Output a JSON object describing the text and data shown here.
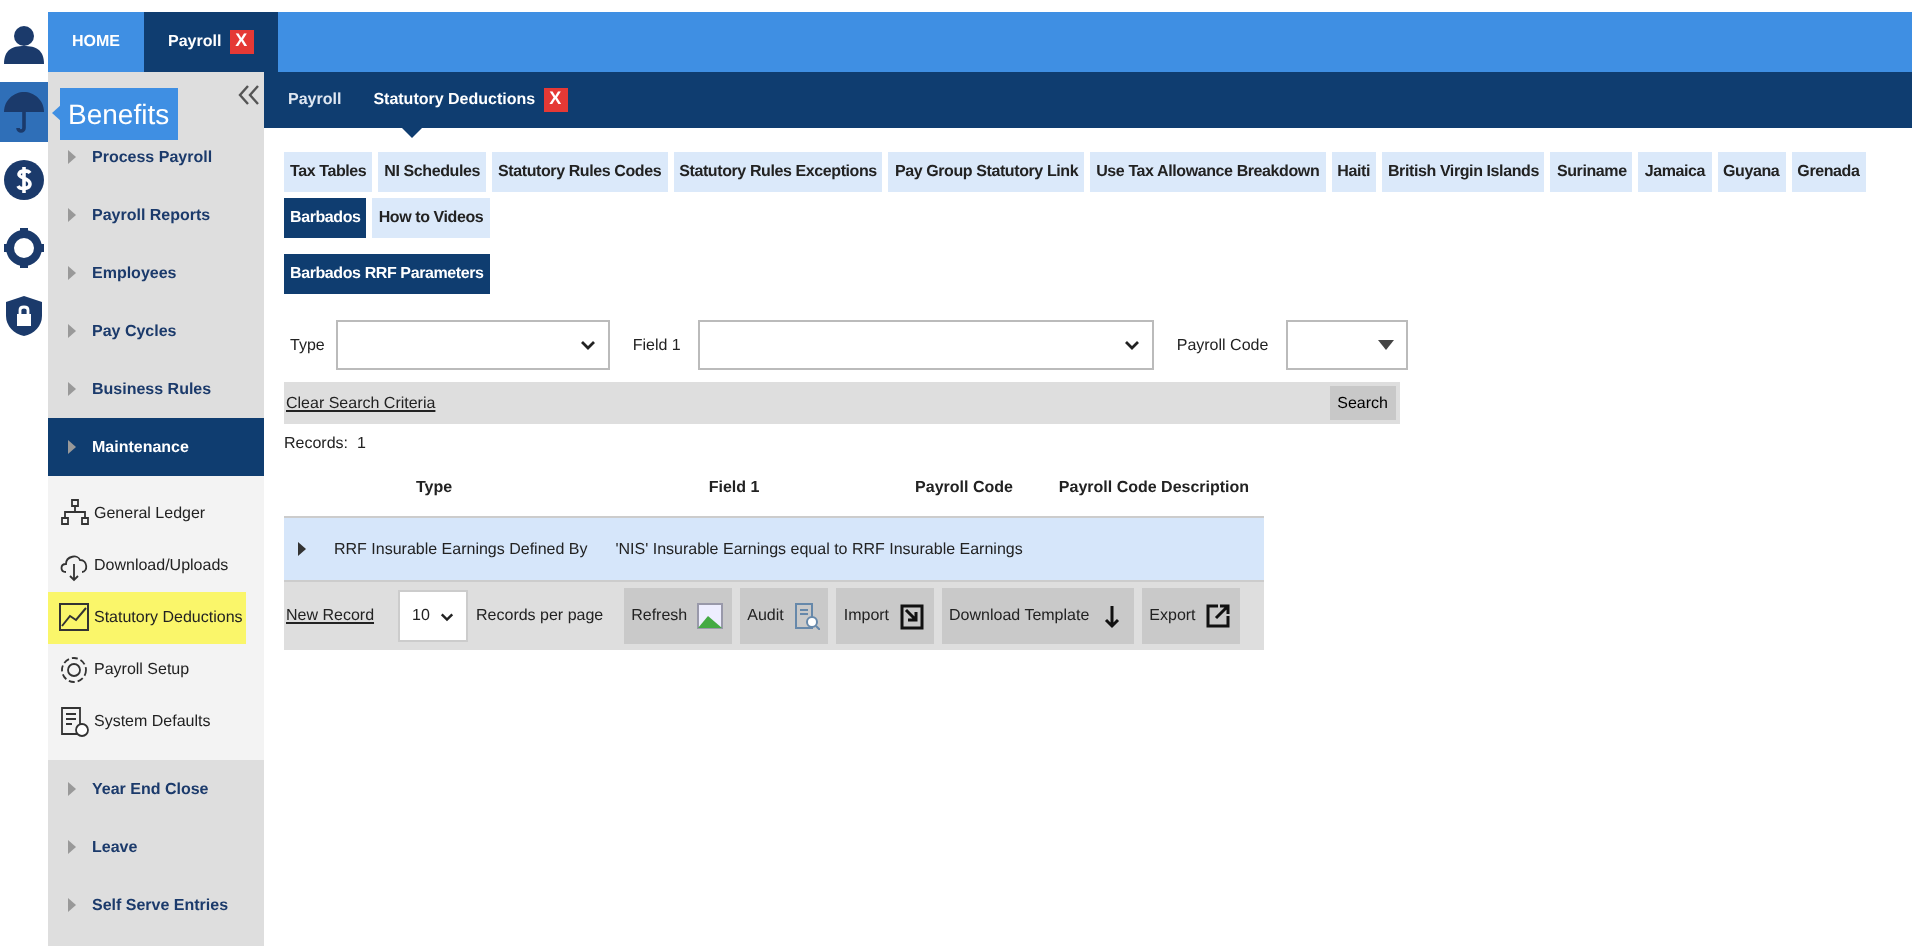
{
  "rail_icons": [
    {
      "kind": "user",
      "selected": false
    },
    {
      "kind": "umbrella",
      "selected": true
    },
    {
      "kind": "dollar",
      "selected": false
    },
    {
      "kind": "gear",
      "selected": false
    },
    {
      "kind": "shield",
      "selected": false
    }
  ],
  "tooltip": "Benefits",
  "top_tabs": [
    {
      "label": "HOME",
      "selected": false
    },
    {
      "label": "Payroll",
      "selected": true,
      "close": "X"
    }
  ],
  "sidebar": {
    "sections": [
      {
        "label": "Process Payroll",
        "expanded": false
      },
      {
        "label": "Payroll Reports",
        "expanded": false
      },
      {
        "label": "Employees",
        "expanded": false
      },
      {
        "label": "Pay Cycles",
        "expanded": false
      },
      {
        "label": "Business Rules",
        "expanded": false
      },
      {
        "label": "Maintenance",
        "expanded": true,
        "children": [
          {
            "label": "General Ledger",
            "kind": "tree",
            "highlighted": false
          },
          {
            "label": "Download/Uploads",
            "kind": "cloud",
            "highlighted": false
          },
          {
            "label": "Statutory Deductions",
            "kind": "chart",
            "highlighted": true
          },
          {
            "label": "Payroll Setup",
            "kind": "gear",
            "highlighted": false
          },
          {
            "label": "System Defaults",
            "kind": "doc",
            "highlighted": false
          }
        ]
      },
      {
        "label": "Year End Close",
        "expanded": false
      },
      {
        "label": "Leave",
        "expanded": false
      },
      {
        "label": "Self Serve Entries",
        "expanded": false
      }
    ]
  },
  "page_tabs": [
    {
      "label": "Payroll",
      "selected": false
    },
    {
      "label": "Statutory Deductions",
      "selected": true,
      "close": "X"
    }
  ],
  "sub_tabs": [
    {
      "label": "Tax Tables",
      "selected": false
    },
    {
      "label": "NI Schedules",
      "selected": false
    },
    {
      "label": "Statutory Rules Codes",
      "selected": false
    },
    {
      "label": "Statutory Rules Exceptions",
      "selected": false
    },
    {
      "label": "Pay Group Statutory Link",
      "selected": false
    },
    {
      "label": "Use Tax Allowance Breakdown",
      "selected": false
    },
    {
      "label": "Haiti",
      "selected": false
    },
    {
      "label": "British Virgin Islands",
      "selected": false
    },
    {
      "label": "Suriname",
      "selected": false
    },
    {
      "label": "Jamaica",
      "selected": false
    },
    {
      "label": "Guyana",
      "selected": false
    },
    {
      "label": "Grenada",
      "selected": false
    },
    {
      "label": "Barbados",
      "selected": true
    },
    {
      "label": "How to Videos",
      "selected": false
    }
  ],
  "section_tabs": [
    {
      "label": "Barbados RRF Parameters",
      "selected": true
    }
  ],
  "filters": [
    {
      "label": "Type",
      "kind": "select"
    },
    {
      "label": "Field 1",
      "kind": "wide"
    },
    {
      "label": "Payroll Code",
      "kind": "small"
    }
  ],
  "clear_link": "Clear Search Criteria",
  "search_button": "Search",
  "records": "Records:  1",
  "table": {
    "columns": [
      "Type",
      "Field 1",
      "Payroll Code",
      "Payroll Code Description"
    ],
    "rows": [
      {
        "expanded": false,
        "cells": [
          "RRF Insurable Earnings Defined By",
          "'NIS' Insurable Earnings equal to RRF Insurable Earnings"
        ]
      }
    ]
  },
  "footer": {
    "new_record": "New Record",
    "page_size": "10",
    "per_page": "Records per page",
    "buttons": [
      {
        "label": "Refresh",
        "kind": "image"
      },
      {
        "label": "Audit",
        "kind": "audit"
      },
      {
        "label": "Import",
        "kind": "import"
      },
      {
        "label": "Download Template",
        "kind": "down"
      },
      {
        "label": "Export",
        "kind": "export"
      }
    ]
  }
}
